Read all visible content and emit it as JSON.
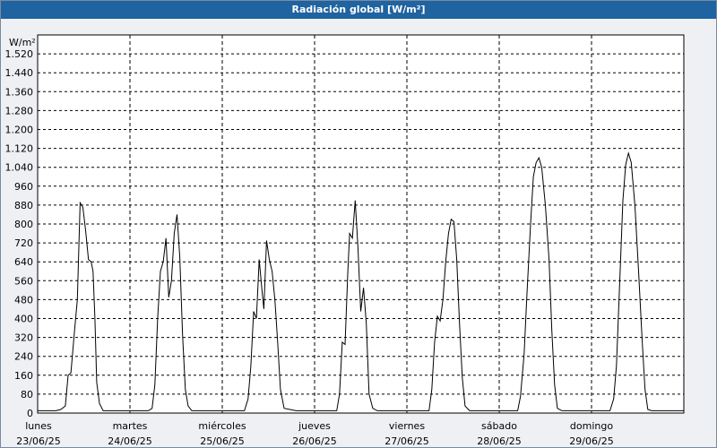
{
  "window": {
    "title": "Radiación global [W/m²]"
  },
  "colors": {
    "title_bar": "#1f63a0",
    "title_text": "#ffffff",
    "line": "#000000",
    "grid": "#000000",
    "background": "#ffffff"
  },
  "chart_data": {
    "type": "line",
    "title": "Radiación global [W/m²]",
    "ylabel": "W/m²",
    "ylim": [
      0,
      1600
    ],
    "yticks": [
      0,
      80,
      160,
      240,
      320,
      400,
      480,
      560,
      640,
      720,
      800,
      880,
      960,
      1040,
      1120,
      1200,
      1280,
      1360,
      1440,
      1520
    ],
    "ytick_labels": [
      "0",
      "80",
      "160",
      "240",
      "320",
      "400",
      "480",
      "560",
      "640",
      "720",
      "800",
      "880",
      "960",
      "1.040",
      "1.120",
      "1.200",
      "1.280",
      "1.360",
      "1.440",
      "1.520"
    ],
    "xlim": [
      0,
      7
    ],
    "xticks": [
      {
        "day": "lunes",
        "date": "23/06/25"
      },
      {
        "day": "martes",
        "date": "24/06/25"
      },
      {
        "day": "miércoles",
        "date": "25/06/25"
      },
      {
        "day": "jueves",
        "date": "26/06/25"
      },
      {
        "day": "viernes",
        "date": "27/06/25"
      },
      {
        "day": "sábado",
        "date": "28/06/25"
      },
      {
        "day": "domingo",
        "date": "29/06/25"
      }
    ],
    "grid": true,
    "series": [
      {
        "points": [
          [
            0.0,
            10
          ],
          [
            0.2,
            10
          ],
          [
            0.25,
            15
          ],
          [
            0.3,
            30
          ],
          [
            0.33,
            160
          ],
          [
            0.36,
            170
          ],
          [
            0.4,
            350
          ],
          [
            0.43,
            480
          ],
          [
            0.46,
            890
          ],
          [
            0.49,
            870
          ],
          [
            0.52,
            770
          ],
          [
            0.55,
            650
          ],
          [
            0.58,
            640
          ],
          [
            0.6,
            600
          ],
          [
            0.62,
            400
          ],
          [
            0.64,
            130
          ],
          [
            0.67,
            40
          ],
          [
            0.71,
            10
          ],
          [
            0.8,
            10
          ],
          [
            1.0,
            10
          ],
          [
            1.2,
            10
          ],
          [
            1.24,
            20
          ],
          [
            1.27,
            120
          ],
          [
            1.3,
            400
          ],
          [
            1.33,
            600
          ],
          [
            1.36,
            640
          ],
          [
            1.39,
            740
          ],
          [
            1.42,
            490
          ],
          [
            1.45,
            560
          ],
          [
            1.48,
            760
          ],
          [
            1.51,
            840
          ],
          [
            1.54,
            660
          ],
          [
            1.57,
            330
          ],
          [
            1.6,
            100
          ],
          [
            1.63,
            30
          ],
          [
            1.67,
            10
          ],
          [
            1.8,
            10
          ],
          [
            2.0,
            10
          ],
          [
            2.24,
            10
          ],
          [
            2.28,
            60
          ],
          [
            2.31,
            200
          ],
          [
            2.34,
            430
          ],
          [
            2.37,
            400
          ],
          [
            2.4,
            650
          ],
          [
            2.43,
            520
          ],
          [
            2.45,
            440
          ],
          [
            2.48,
            730
          ],
          [
            2.51,
            650
          ],
          [
            2.54,
            600
          ],
          [
            2.57,
            480
          ],
          [
            2.6,
            300
          ],
          [
            2.63,
            100
          ],
          [
            2.67,
            20
          ],
          [
            2.8,
            10
          ],
          [
            3.0,
            10
          ],
          [
            3.24,
            10
          ],
          [
            3.27,
            80
          ],
          [
            3.3,
            300
          ],
          [
            3.33,
            290
          ],
          [
            3.36,
            600
          ],
          [
            3.38,
            760
          ],
          [
            3.41,
            740
          ],
          [
            3.44,
            900
          ],
          [
            3.47,
            700
          ],
          [
            3.5,
            430
          ],
          [
            3.53,
            530
          ],
          [
            3.56,
            380
          ],
          [
            3.59,
            80
          ],
          [
            3.63,
            20
          ],
          [
            3.68,
            10
          ],
          [
            3.8,
            10
          ],
          [
            4.0,
            10
          ],
          [
            4.24,
            10
          ],
          [
            4.27,
            100
          ],
          [
            4.3,
            300
          ],
          [
            4.33,
            410
          ],
          [
            4.36,
            390
          ],
          [
            4.39,
            480
          ],
          [
            4.42,
            640
          ],
          [
            4.45,
            760
          ],
          [
            4.48,
            820
          ],
          [
            4.51,
            810
          ],
          [
            4.54,
            650
          ],
          [
            4.57,
            380
          ],
          [
            4.6,
            150
          ],
          [
            4.63,
            30
          ],
          [
            4.68,
            10
          ],
          [
            4.8,
            10
          ],
          [
            5.0,
            10
          ],
          [
            5.2,
            10
          ],
          [
            5.23,
            70
          ],
          [
            5.27,
            250
          ],
          [
            5.3,
            500
          ],
          [
            5.34,
            800
          ],
          [
            5.37,
            1000
          ],
          [
            5.4,
            1060
          ],
          [
            5.43,
            1080
          ],
          [
            5.46,
            1040
          ],
          [
            5.5,
            880
          ],
          [
            5.54,
            650
          ],
          [
            5.57,
            350
          ],
          [
            5.6,
            120
          ],
          [
            5.63,
            20
          ],
          [
            5.68,
            10
          ],
          [
            5.8,
            10
          ],
          [
            6.0,
            10
          ],
          [
            6.2,
            10
          ],
          [
            6.24,
            60
          ],
          [
            6.27,
            200
          ],
          [
            6.3,
            500
          ],
          [
            6.34,
            900
          ],
          [
            6.37,
            1050
          ],
          [
            6.4,
            1100
          ],
          [
            6.43,
            1060
          ],
          [
            6.47,
            880
          ],
          [
            6.51,
            600
          ],
          [
            6.55,
            300
          ],
          [
            6.58,
            100
          ],
          [
            6.61,
            15
          ],
          [
            6.65,
            10
          ],
          [
            7.0,
            10
          ]
        ]
      }
    ]
  }
}
